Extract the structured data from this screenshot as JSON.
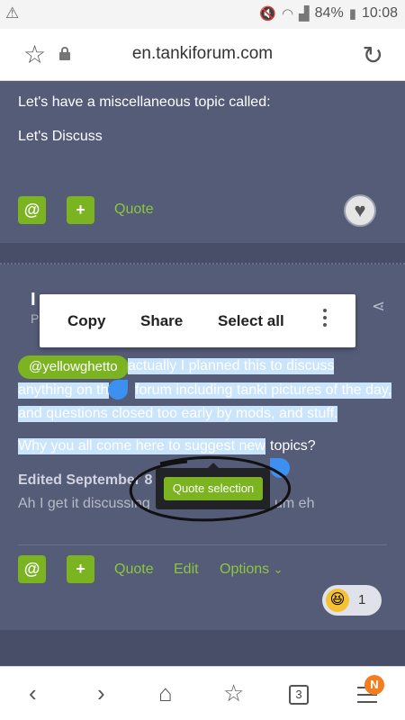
{
  "status_bar": {
    "battery": "84%",
    "time": "10:08"
  },
  "browser": {
    "url": "en.tankiforum.com"
  },
  "post1": {
    "lines": [
      "Let's have a miscellaneous topic called:",
      "Let's Discuss"
    ],
    "mention_label": "@",
    "plus_label": "+",
    "quote_label": "Quote"
  },
  "post2": {
    "author_initial": "I",
    "author_sub": "P",
    "context_menu": {
      "copy": "Copy",
      "share": "Share",
      "select_all": "Select all"
    },
    "mention": "@yellowghetto",
    "line1": "actually I planned this to discuss",
    "line2a": "anything on th",
    "line2b": "forum including tanki pictures of the day,",
    "line3": "and questions closed too early by mods, and stuff.",
    "line4a": "Why you all come here to suggest new ",
    "line4b": "topics?",
    "edited_a": "Edited September 8 b",
    "edited_b_left": "Ah I get it discussing",
    "edited_b_right": "um eh",
    "quote_selection": "Quote selection",
    "actions": {
      "mention": "@",
      "plus": "+",
      "quote": "Quote",
      "edit": "Edit",
      "options": "Options"
    },
    "reaction_count": "1"
  },
  "bottom_bar": {
    "tab_count": "3",
    "badge": "N"
  }
}
